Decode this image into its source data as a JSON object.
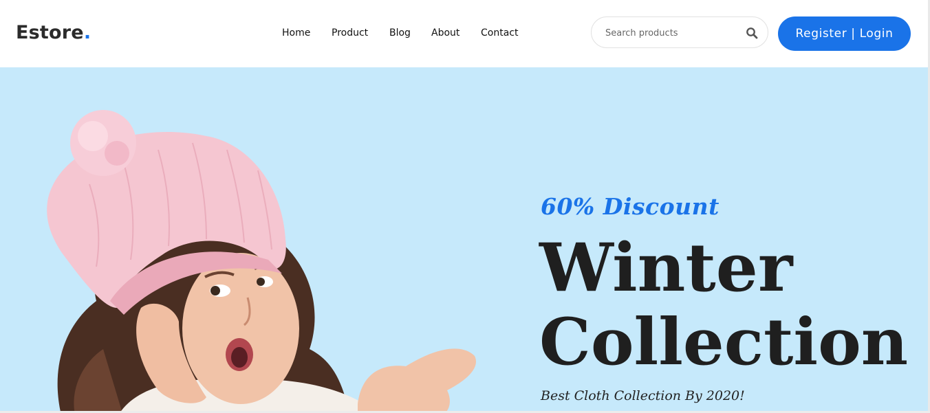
{
  "brand": {
    "name": "Estore",
    "dot": ".",
    "accent_color": "#1a73e8"
  },
  "nav": {
    "items": [
      {
        "label": "Home"
      },
      {
        "label": "Product"
      },
      {
        "label": "Blog"
      },
      {
        "label": "About"
      },
      {
        "label": "Contact"
      }
    ]
  },
  "search": {
    "placeholder": "Search products",
    "value": "",
    "icon": "search-icon"
  },
  "auth": {
    "label": "Register | Login",
    "color": "#1a73e8"
  },
  "hero": {
    "background_color": "#c6e9fb",
    "discount": "60% Discount",
    "title_line1": "Winter",
    "title_line2": "Collection",
    "subtitle": "Best Cloth Collection By 2020!",
    "image": "girl-in-pink-knit-hat"
  }
}
